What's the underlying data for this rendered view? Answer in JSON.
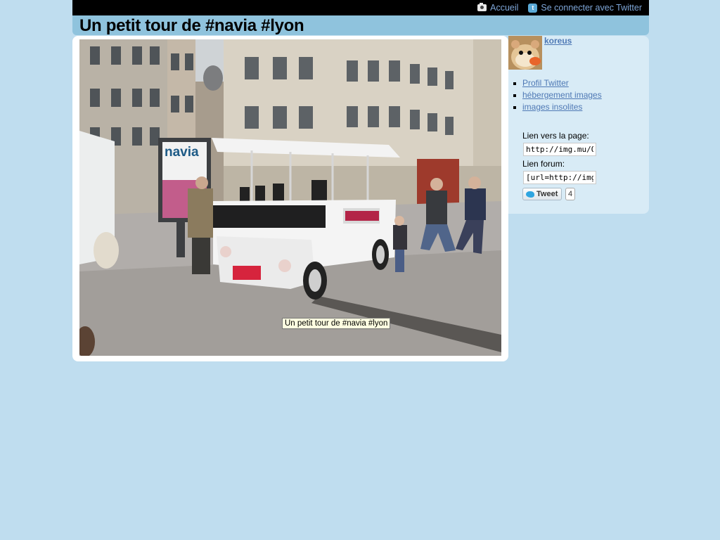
{
  "topnav": {
    "home_label": "Accueil",
    "home_icon": "camera-icon",
    "twitter_connect_label": "Se connecter avec Twitter",
    "twitter_icon": "twitter-icon"
  },
  "page": {
    "title": "Un petit tour de #navia #lyon"
  },
  "photo": {
    "tooltip": "Un petit tour de #navia #lyon",
    "sign_text": "navia"
  },
  "sidebar": {
    "username": "koreus",
    "links": [
      {
        "label": "Profil Twitter"
      },
      {
        "label": "hébergement images"
      },
      {
        "label": "images insolites"
      }
    ],
    "page_link_label": "Lien vers la page:",
    "page_link_value": "http://img.mu/Oy",
    "forum_link_label": "Lien forum:",
    "forum_link_value": "[url=http://img.m",
    "tweet_label": "Tweet",
    "tweet_count": "4"
  },
  "colors": {
    "background": "#bfddef",
    "title_bar": "#8fc3dd",
    "link": "#4f79b5",
    "topbar": "#000000"
  }
}
